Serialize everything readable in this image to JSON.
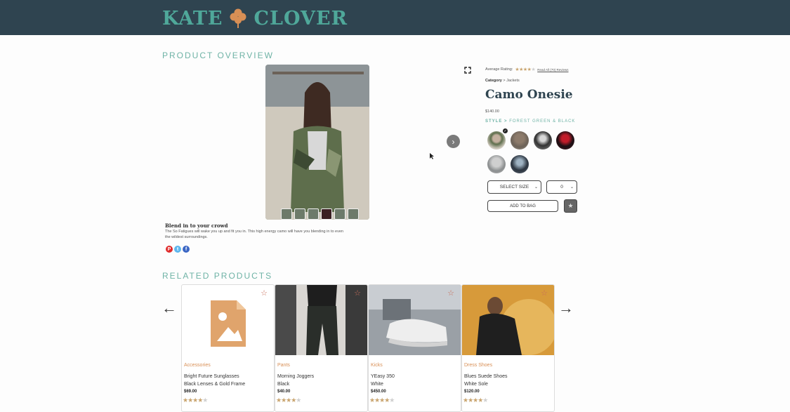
{
  "brand": {
    "name_left": "KATE",
    "name_right": "CLOVER"
  },
  "overview": {
    "section_title": "PRODUCT OVERVIEW",
    "description_title": "Blend in to your crowd",
    "description_text": "The So Fatigues will wake you up and fit you in. This high energy camo will have you blending in to even the wildest surroundings.",
    "social": [
      "P",
      "t",
      "f"
    ]
  },
  "product": {
    "rating_label": "Average Rating:",
    "rating_value": 3.5,
    "reviews_link": "Read All (70) Reviews",
    "category_label": "Category",
    "category_value": "> Jackets",
    "name": "Camo Onesie",
    "price": "$140.00",
    "style_label": "STYLE >",
    "style_value": "FOREST GREEN & BLACK",
    "size_select": "SELECT SIZE",
    "quantity_select": "0",
    "add_to_bag": "ADD TO BAG",
    "favorite_icon": "★",
    "next_icon": "›"
  },
  "related": {
    "section_title": "RELATED PRODUCTS",
    "prev_arrow": "🡐",
    "next_arrow": "🡒",
    "items": [
      {
        "category": "Accessories",
        "name": "Bright Future Sunglasses",
        "variant": "Black Lenses & Gold Frame",
        "price": "$69.00",
        "rating": 4
      },
      {
        "category": "Pants",
        "name": "Morning Joggers",
        "variant": "Black",
        "price": "$40.00",
        "rating": 3.5
      },
      {
        "category": "Kicks",
        "name": "YEasy 350",
        "variant": "White",
        "price": "$450.00",
        "rating": 3.5
      },
      {
        "category": "Dress Shoes",
        "name": "Blues Suede Shoes",
        "variant": "White Sole",
        "price": "$120.00",
        "rating": 3.5
      }
    ]
  }
}
